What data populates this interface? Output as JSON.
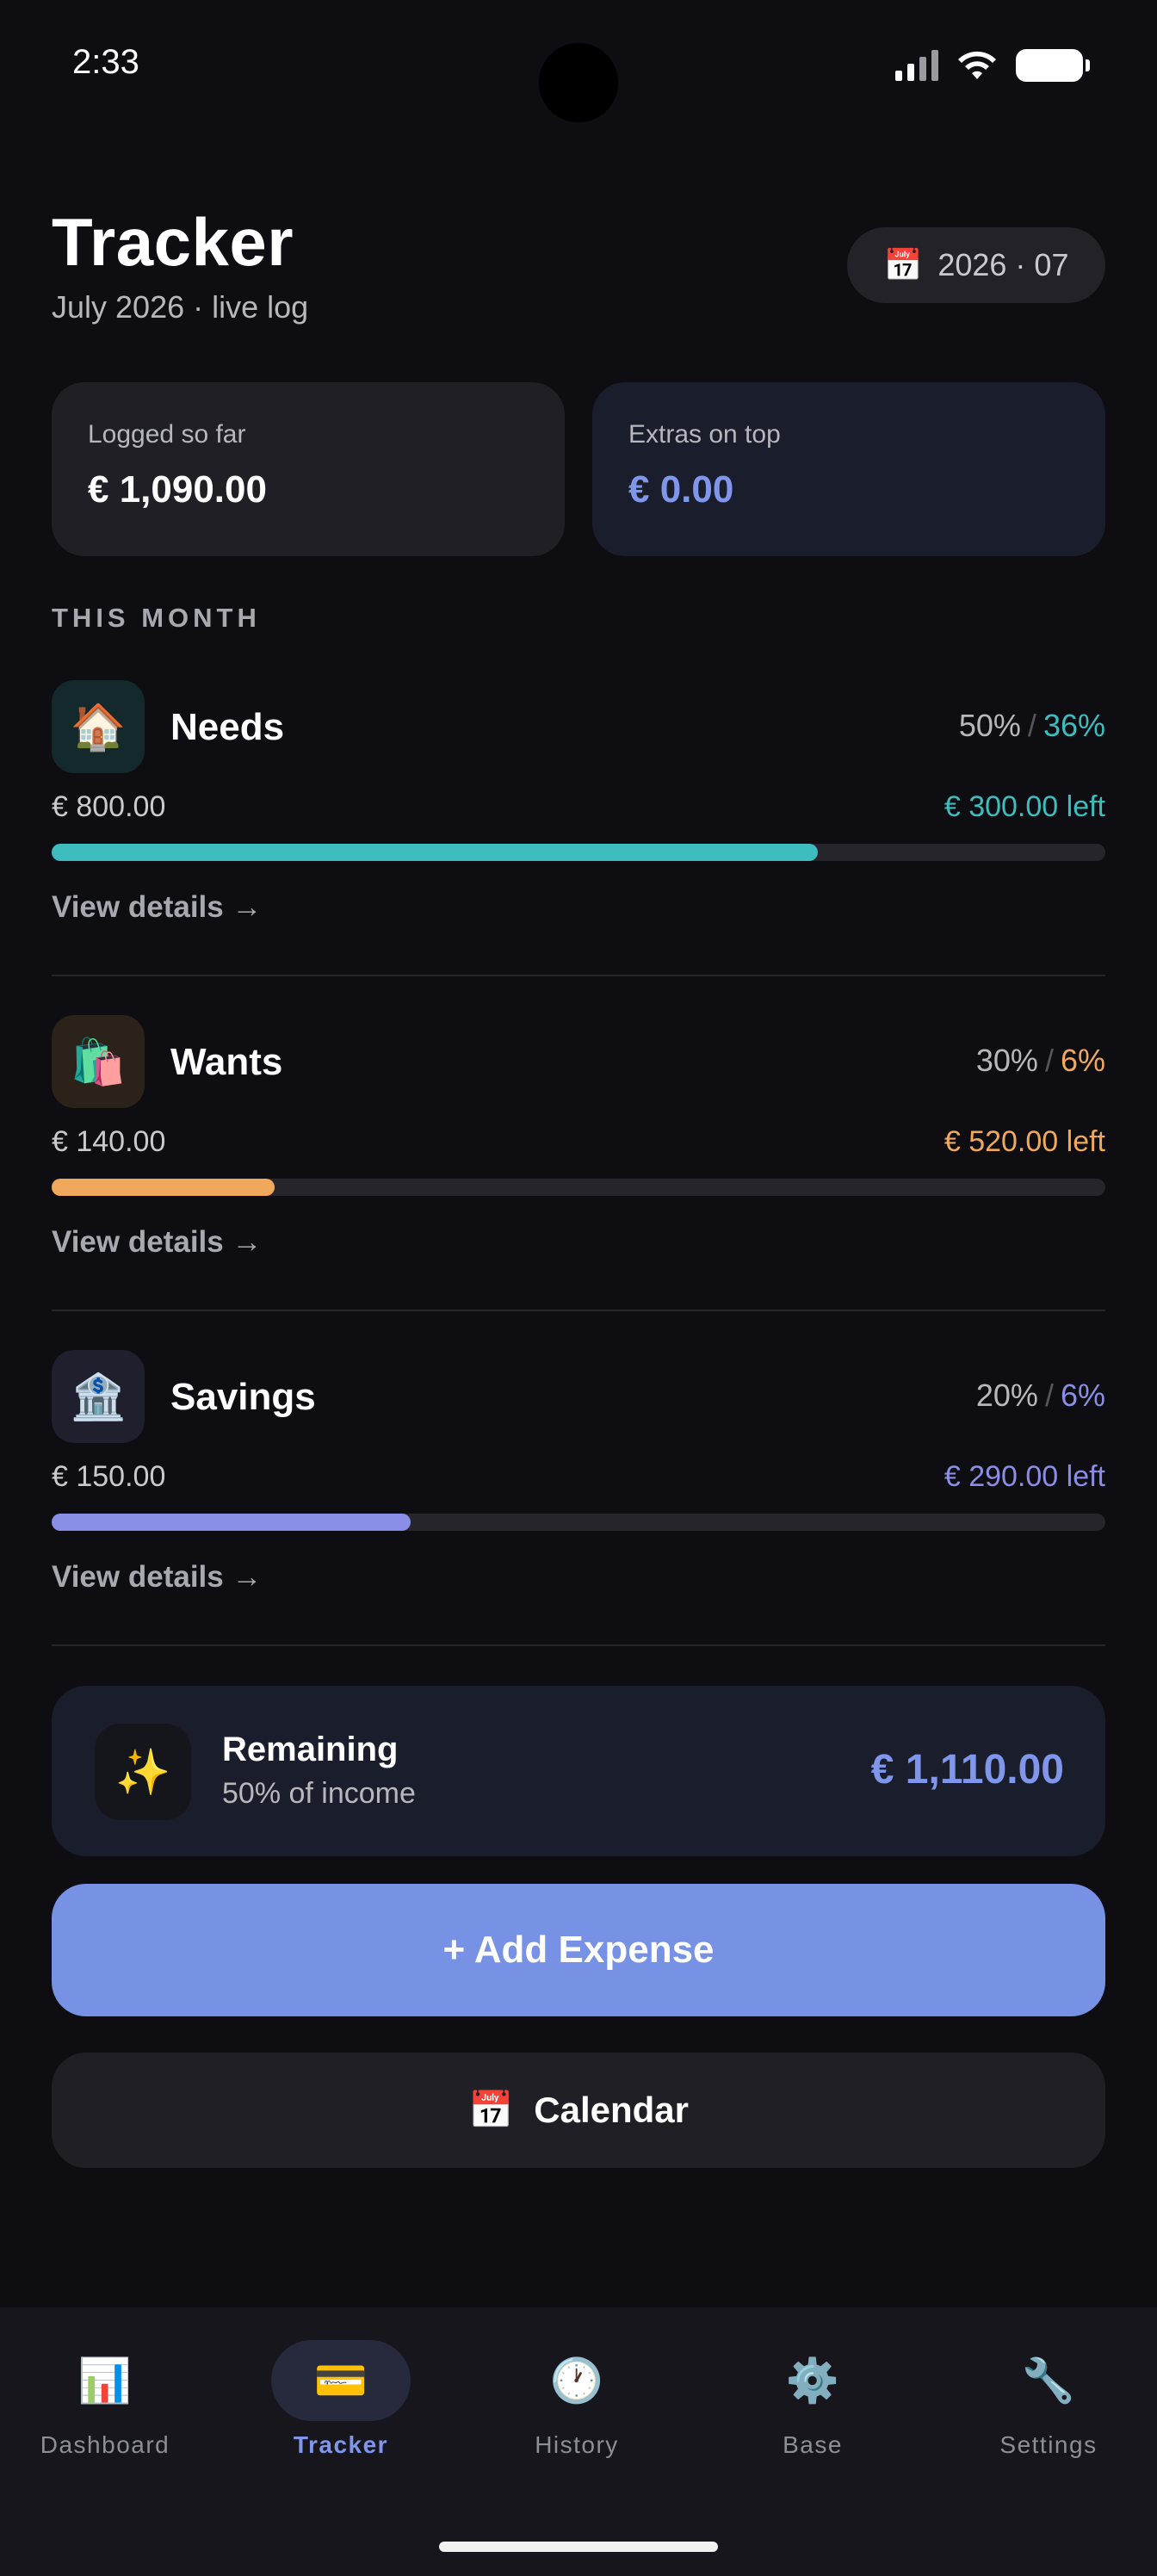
{
  "status_bar": {
    "time": "2:33"
  },
  "header": {
    "title": "Tracker",
    "subtitle": "July 2026 · live log",
    "month_pill": {
      "icon": "calendar-icon",
      "glyph": "📅",
      "label": "2026 · 07"
    }
  },
  "summary": {
    "logged": {
      "label": "Logged so far",
      "value": "€ 1,090.00"
    },
    "extras": {
      "label": "Extras on top",
      "value": "€ 0.00"
    }
  },
  "section_label": "THIS MONTH",
  "categories": [
    {
      "name": "Needs",
      "icon": "house-icon",
      "glyph": "🏠",
      "target_pct": "50%",
      "used_pct": "36%",
      "spent": "€ 800.00",
      "left": "€ 300.00 left",
      "progress": 0.727,
      "color": "#3dbdbd",
      "icon_bg": "#14292b",
      "link": "View details →"
    },
    {
      "name": "Wants",
      "icon": "shopping-bags-icon",
      "glyph": "🛍️",
      "target_pct": "30%",
      "used_pct": "6%",
      "spent": "€ 140.00",
      "left": "€ 520.00 left",
      "progress": 0.212,
      "color": "#f0a95c",
      "icon_bg": "#2b2219",
      "link": "View details →"
    },
    {
      "name": "Savings",
      "icon": "bank-icon",
      "glyph": "🏦",
      "target_pct": "20%",
      "used_pct": "6%",
      "spent": "€ 150.00",
      "left": "€ 290.00 left",
      "progress": 0.341,
      "color": "#8b8ee6",
      "icon_bg": "#1f1f2e",
      "link": "View details →"
    }
  ],
  "remaining": {
    "icon": "sparkles-icon",
    "glyph": "✨",
    "title": "Remaining",
    "subtitle": "50% of income",
    "value": "€ 1,110.00"
  },
  "actions": {
    "add_expense": "+ Add Expense",
    "calendar": {
      "icon": "calendar-icon",
      "glyph": "📅",
      "label": "Calendar"
    }
  },
  "nav": [
    {
      "label": "Dashboard",
      "icon": "bar-chart-icon",
      "glyph": "📊",
      "active": false
    },
    {
      "label": "Tracker",
      "icon": "credit-card-icon",
      "glyph": "💳",
      "active": true
    },
    {
      "label": "History",
      "icon": "clock-icon",
      "glyph": "🕐",
      "active": false
    },
    {
      "label": "Base",
      "icon": "gear-icon",
      "glyph": "⚙️",
      "active": false
    },
    {
      "label": "Settings",
      "icon": "wrench-icon",
      "glyph": "🔧",
      "active": false
    }
  ],
  "colors": {
    "accent": "#7791e4",
    "background": "#0d0d12"
  }
}
